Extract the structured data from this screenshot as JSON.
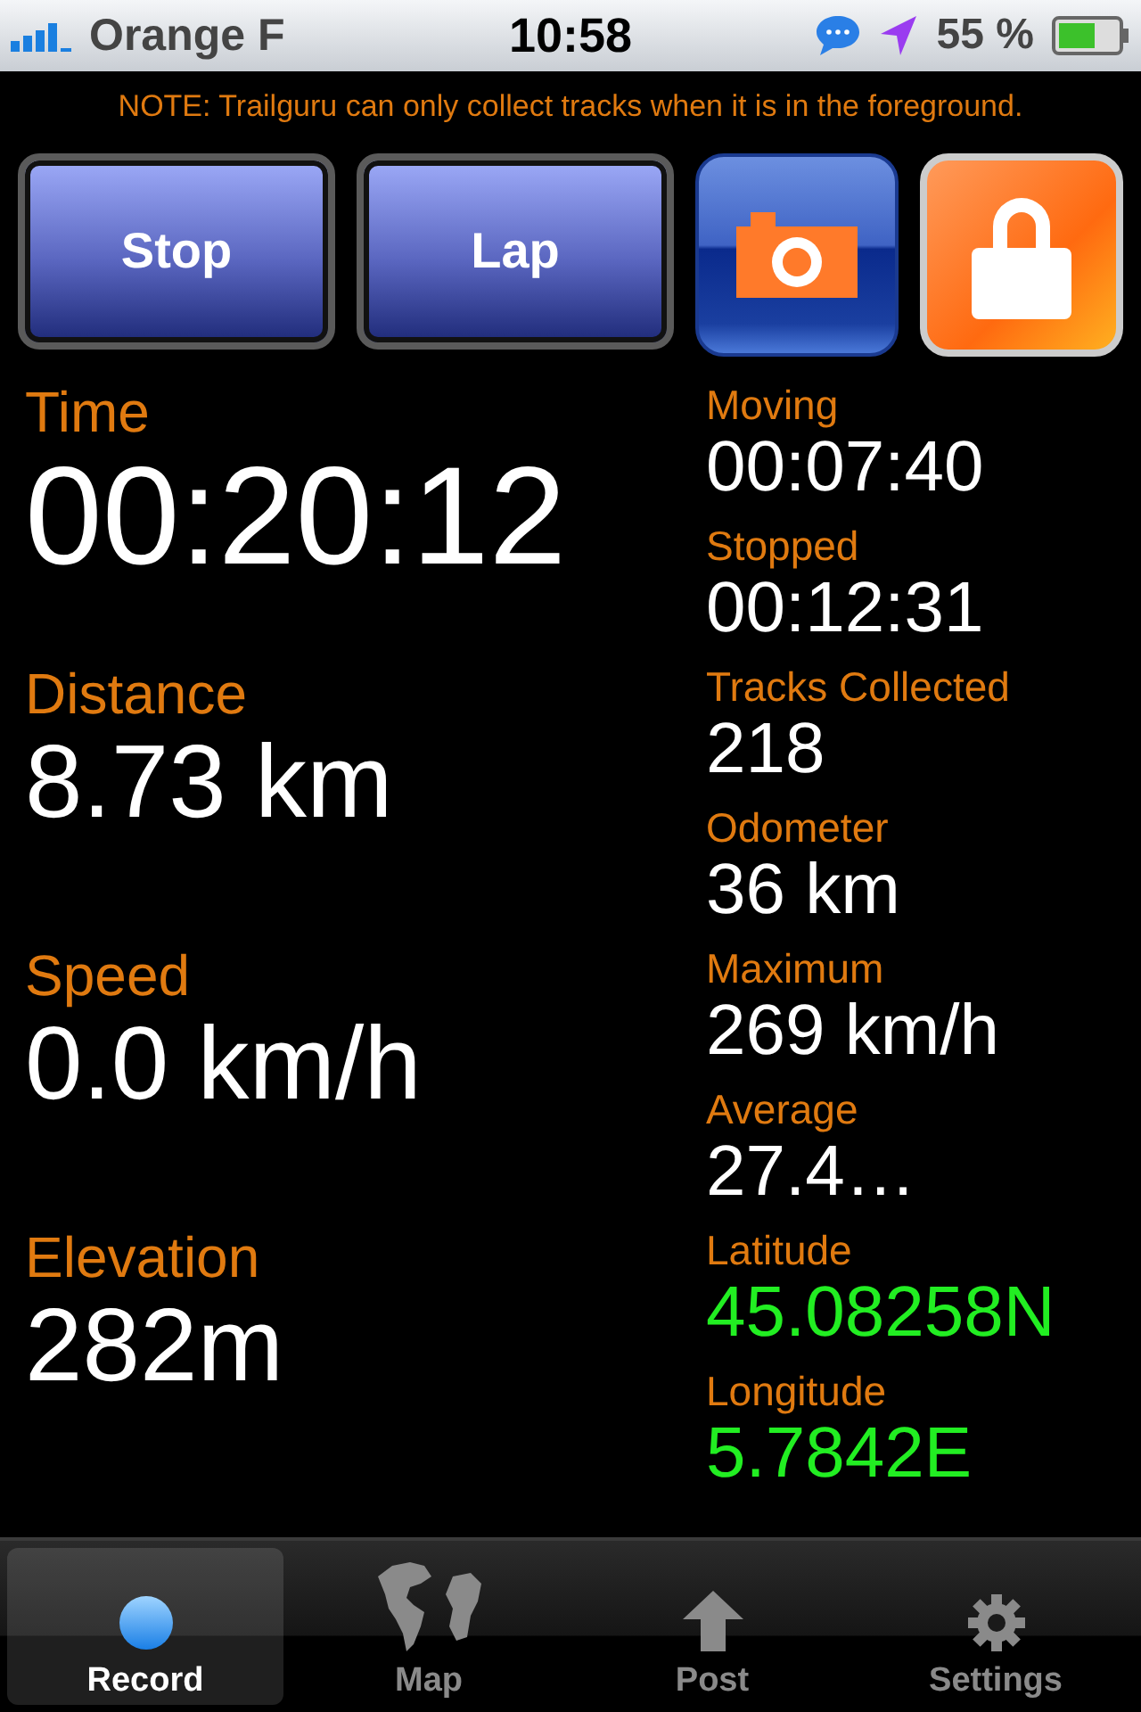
{
  "status_bar": {
    "carrier": "Orange F",
    "time": "10:58",
    "battery": "55 %"
  },
  "note": "NOTE: Trailguru can only collect tracks when it is in the foreground.",
  "buttons": [
    "Stop",
    "Lap"
  ],
  "main_stats": [
    {
      "label": "Time",
      "value": "00:20:12"
    },
    {
      "label": "Distance",
      "value": "8.73 km"
    },
    {
      "label": "Speed",
      "value": "0.0 km/h"
    },
    {
      "label": "Elevation",
      "value": "282m"
    }
  ],
  "side_stats": [
    {
      "label": "Moving",
      "value": "00:07:40",
      "color": "#ffffff"
    },
    {
      "label": "Stopped",
      "value": "00:12:31",
      "color": "#ffffff"
    },
    {
      "label": "Tracks Collected",
      "value": "218",
      "color": "#ffffff"
    },
    {
      "label": "Odometer",
      "value": "36 km",
      "color": "#ffffff"
    },
    {
      "label": "Maximum",
      "value": "269 km/h",
      "color": "#ffffff"
    },
    {
      "label": "Average",
      "value": "27.4…",
      "color": "#ffffff"
    },
    {
      "label": "Latitude",
      "value": "45.08258N",
      "color": "#22ee22"
    },
    {
      "label": "Longitude",
      "value": "5.7842E",
      "color": "#22ee22"
    }
  ],
  "tabs": [
    {
      "label": "Record",
      "selected": true,
      "kind": "record"
    },
    {
      "label": "Map",
      "selected": false,
      "kind": "map"
    },
    {
      "label": "Post",
      "selected": false,
      "kind": "post"
    },
    {
      "label": "Settings",
      "selected": false,
      "kind": "settings"
    }
  ]
}
